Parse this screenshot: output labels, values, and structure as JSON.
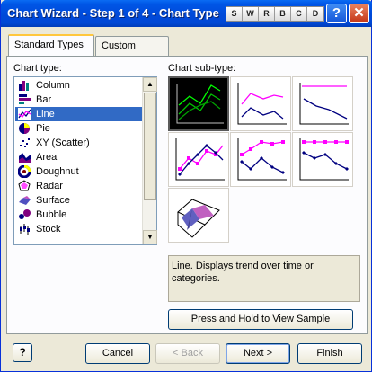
{
  "window": {
    "title": "Chart Wizard - Step 1 of 4 - Chart Type",
    "toolbar_letters": [
      "S",
      "W",
      "R",
      "B",
      "C",
      "D"
    ],
    "help_glyph": "?",
    "close_glyph": "✕"
  },
  "tabs": [
    {
      "label": "Standard Types",
      "active": true
    },
    {
      "label": "Custom Types",
      "active": false
    }
  ],
  "chart_type": {
    "label": "Chart type:",
    "items": [
      {
        "label": "Column",
        "icon": "column-chart-icon"
      },
      {
        "label": "Bar",
        "icon": "bar-chart-icon"
      },
      {
        "label": "Line",
        "icon": "line-chart-icon",
        "selected": true
      },
      {
        "label": "Pie",
        "icon": "pie-chart-icon"
      },
      {
        "label": "XY (Scatter)",
        "icon": "scatter-chart-icon"
      },
      {
        "label": "Area",
        "icon": "area-chart-icon"
      },
      {
        "label": "Doughnut",
        "icon": "doughnut-chart-icon"
      },
      {
        "label": "Radar",
        "icon": "radar-chart-icon"
      },
      {
        "label": "Surface",
        "icon": "surface-chart-icon"
      },
      {
        "label": "Bubble",
        "icon": "bubble-chart-icon"
      },
      {
        "label": "Stock",
        "icon": "stock-chart-icon"
      }
    ]
  },
  "chart_subtype": {
    "label": "Chart sub-type:",
    "items": [
      {
        "icon": "line-subtype-icon",
        "selected": true
      },
      {
        "icon": "stacked-line-subtype-icon"
      },
      {
        "icon": "100-stacked-line-subtype-icon"
      },
      {
        "icon": "line-markers-subtype-icon"
      },
      {
        "icon": "stacked-line-markers-subtype-icon"
      },
      {
        "icon": "100-stacked-line-markers-subtype-icon"
      },
      {
        "icon": "3d-line-subtype-icon"
      }
    ]
  },
  "description": "Line. Displays trend over time or categories.",
  "buttons": {
    "view_sample": "Press and Hold to View Sample",
    "cancel": "Cancel",
    "back": "< Back",
    "next": "Next >",
    "finish": "Finish",
    "help": "?"
  },
  "colors": {
    "titlebar": "#0049d8",
    "selection": "#316ac5",
    "series_magenta": "#ff00ff",
    "series_navy": "#000080",
    "series_green": "#00c000"
  }
}
